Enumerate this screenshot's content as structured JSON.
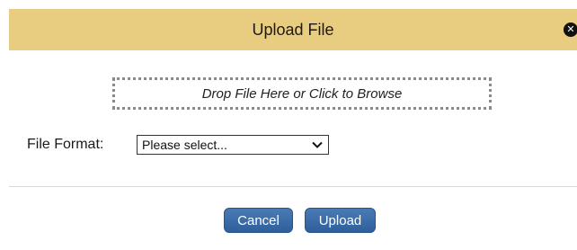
{
  "dialog": {
    "title": "Upload File",
    "close_icon": "close-icon"
  },
  "dropzone": {
    "text": "Drop File Here or Click to Browse"
  },
  "file_format": {
    "label": "File Format:",
    "selected": "Please select...",
    "chevron_icon": "chevron-down-icon"
  },
  "actions": {
    "cancel_label": "Cancel",
    "upload_label": "Upload"
  },
  "colors": {
    "titlebar": "#e8cd80",
    "button": "#3a6ca8"
  }
}
